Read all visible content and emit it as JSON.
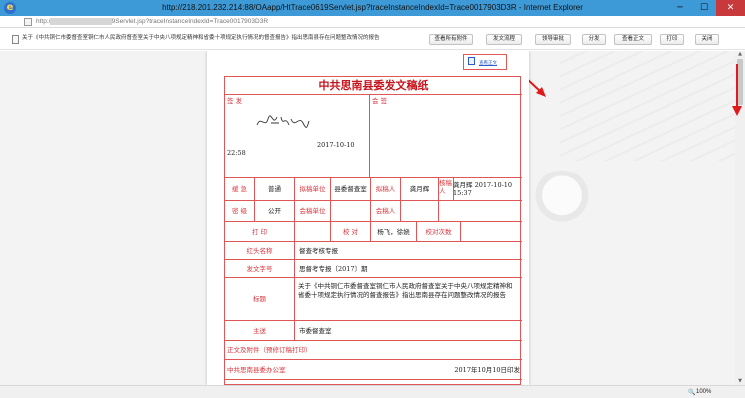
{
  "window": {
    "title": "http://218.201.232.214:88/OAapp/HtTrace0619Servlet.jsp?traceInstanceIndexId=Trace0017903D3R - Internet Explorer",
    "ie_icon": "e",
    "min": "─",
    "max": "☐",
    "close": "✕"
  },
  "address": {
    "url": "http://              /OAapp/HtTrace0619Servlet.jsp?traceInstanceIndexId=Trace0017903D3R"
  },
  "toolbar": {
    "doc_title": "关于《中共铜仁市委督查室铜仁市人民政府督查室关于中央八项规定精神和省委十项规定执行情况的督查报告》指出思南县存在问题整改情况的报告",
    "buttons": [
      "查看所有附件",
      "发文流程",
      "领导审批",
      "分发",
      "查看正文",
      "打印",
      "关闭"
    ]
  },
  "document": {
    "view_body_link": "查看正文",
    "form_title": "中共思南县委发文稿纸",
    "signoff_label": "签 发",
    "countersign_label": "会 签",
    "signoff_date": "2017-10-10",
    "signoff_time": "22:58",
    "row1": {
      "urgency_label": "缓 急",
      "urgency_value": "普通",
      "drafting_unit_label": "拟稿单位",
      "drafting_unit_value": "县委督查室",
      "drafter_label": "拟稿人",
      "drafter_value": "龚月辉",
      "verifier_label": "核稿人",
      "verifier_value": "龚月辉  2017-10-10 15:37"
    },
    "row2": {
      "secrecy_label": "密 级",
      "secrecy_value": "公开",
      "sealing_unit_label": "会稿单位",
      "sealing_unit_value": "",
      "cosigner_label": "会稿人",
      "cosigner_value": ""
    },
    "row3": {
      "typist_label": "打 印",
      "typist_value": "",
      "proofread_label": "校 对",
      "proofread_value": "杨飞，徐娆",
      "proof_count_label": "校对次数",
      "proof_count_value": ""
    },
    "header_name_label": "红头名称",
    "header_name_value": "督查考核专报",
    "doc_number_label": "发文字号",
    "doc_number_value": "思督考专报〔2017〕期",
    "subject_label": "标题",
    "subject_value": "关于《中共铜仁市委督查室铜仁市人民政府督查室关于中央八项规定精神和省委十项规定执行情况的督查报告》指出思南县存在问题整改情况的报告",
    "main_recipient_label": "主送",
    "main_recipient_value": "市委督查室",
    "body_attach_label": "正文及附件（预修订稿打印）",
    "issuer": "中共思南县委办公室",
    "issue_date": "2017年10月10日印发"
  },
  "status": {
    "zoom": "100%",
    "zoom_icon": "🔍"
  },
  "colors": {
    "form_red": "#e05656",
    "title_red": "#c6141c",
    "titlebar_blue": "#3d9ad6",
    "arrow_red": "#e01a1a"
  }
}
